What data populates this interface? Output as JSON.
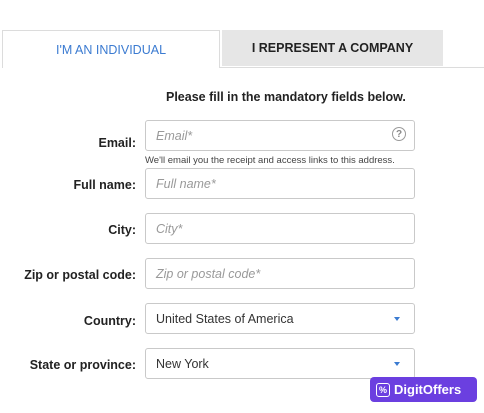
{
  "tabs": {
    "individual": "I'M AN INDIVIDUAL",
    "company": "I REPRESENT A COMPANY"
  },
  "instructions": "Please fill in the mandatory fields below.",
  "form": {
    "email": {
      "label": "Email:",
      "placeholder": "Email*",
      "hint": "We'll email you the receipt and access links to this address."
    },
    "full_name": {
      "label": "Full name:",
      "placeholder": "Full name*"
    },
    "city": {
      "label": "City:",
      "placeholder": "City*"
    },
    "zip": {
      "label": "Zip or postal code:",
      "placeholder": "Zip or postal code*"
    },
    "country": {
      "label": "Country:",
      "value": "United States of America"
    },
    "state": {
      "label": "State or province:",
      "value": "New York"
    }
  },
  "icons": {
    "help": "question-circle-icon",
    "dropdown": "caret-down-icon",
    "logo": "percent-tag-icon"
  },
  "badge": {
    "text": "DigitOffers",
    "icon_glyph": "%"
  },
  "colors": {
    "accent": "#3b7bd1",
    "badge": "#6b3fe0",
    "inactive_tab": "#e6e6e6"
  }
}
